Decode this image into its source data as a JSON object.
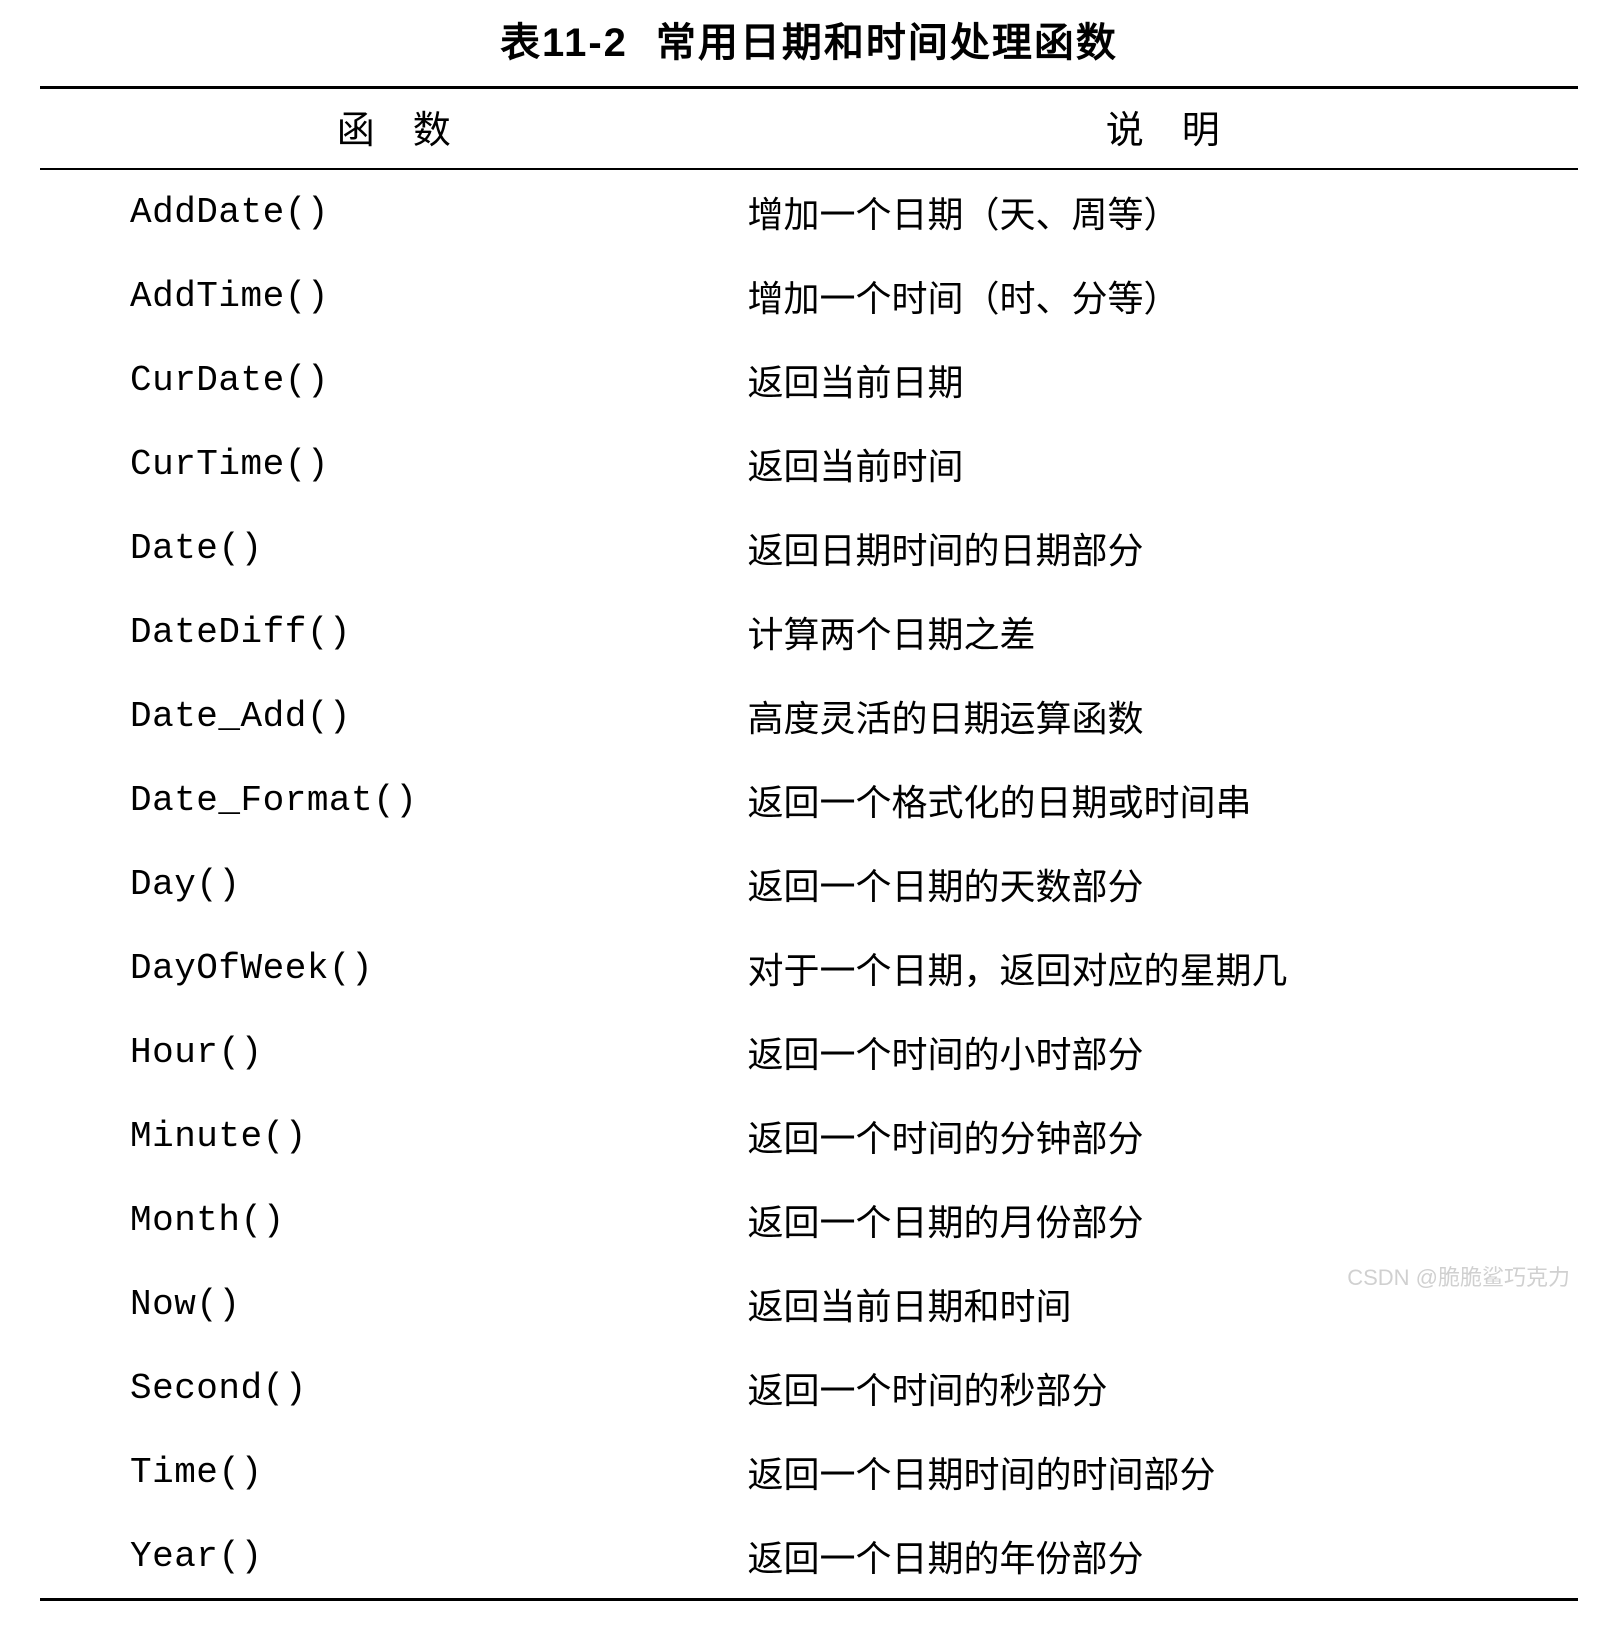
{
  "caption": {
    "label": "表11-2",
    "title": "常用日期和时间处理函数"
  },
  "headers": {
    "function": "函　数",
    "description": "说　明"
  },
  "rows": [
    {
      "func": "AddDate()",
      "desc": "增加一个日期（天、周等）"
    },
    {
      "func": "AddTime()",
      "desc": "增加一个时间（时、分等）"
    },
    {
      "func": "CurDate()",
      "desc": "返回当前日期"
    },
    {
      "func": "CurTime()",
      "desc": "返回当前时间"
    },
    {
      "func": "Date()",
      "desc": "返回日期时间的日期部分"
    },
    {
      "func": "DateDiff()",
      "desc": "计算两个日期之差"
    },
    {
      "func": "Date_Add()",
      "desc": "高度灵活的日期运算函数"
    },
    {
      "func": "Date_Format()",
      "desc": "返回一个格式化的日期或时间串"
    },
    {
      "func": "Day()",
      "desc": "返回一个日期的天数部分"
    },
    {
      "func": "DayOfWeek()",
      "desc": "对于一个日期，返回对应的星期几"
    },
    {
      "func": "Hour()",
      "desc": "返回一个时间的小时部分"
    },
    {
      "func": "Minute()",
      "desc": "返回一个时间的分钟部分"
    },
    {
      "func": "Month()",
      "desc": "返回一个日期的月份部分"
    },
    {
      "func": "Now()",
      "desc": "返回当前日期和时间"
    },
    {
      "func": "Second()",
      "desc": "返回一个时间的秒部分"
    },
    {
      "func": "Time()",
      "desc": "返回一个日期时间的时间部分"
    },
    {
      "func": "Year()",
      "desc": "返回一个日期的年份部分"
    }
  ],
  "watermark": "CSDN @脆脆鲨巧克力"
}
